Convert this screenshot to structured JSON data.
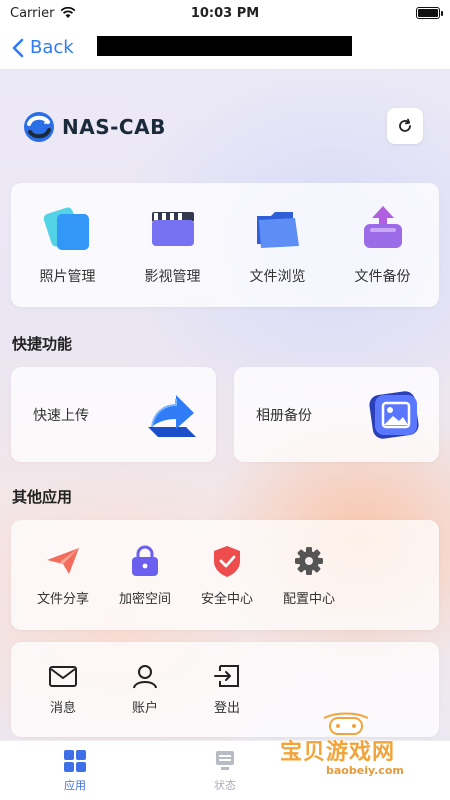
{
  "status_bar": {
    "carrier": "Carrier",
    "time": "10:03 PM"
  },
  "nav": {
    "back_label": "Back"
  },
  "brand": {
    "name": "NAS-CAB",
    "accent": "#2b6fe8"
  },
  "main_tiles": [
    {
      "label": "照片管理",
      "icon": "photos-icon"
    },
    {
      "label": "影视管理",
      "icon": "video-icon"
    },
    {
      "label": "文件浏览",
      "icon": "folder-icon"
    },
    {
      "label": "文件备份",
      "icon": "backup-icon"
    }
  ],
  "quick": {
    "title": "快捷功能",
    "items": [
      {
        "label": "快速上传",
        "icon": "upload-arrow-icon"
      },
      {
        "label": "相册备份",
        "icon": "album-icon"
      }
    ]
  },
  "other": {
    "title": "其他应用",
    "items": [
      {
        "label": "文件分享",
        "icon": "paper-plane-icon"
      },
      {
        "label": "加密空间",
        "icon": "lock-icon"
      },
      {
        "label": "安全中心",
        "icon": "shield-icon"
      },
      {
        "label": "配置中心",
        "icon": "gear-icon"
      }
    ]
  },
  "account_items": [
    {
      "label": "消息",
      "icon": "mail-icon"
    },
    {
      "label": "账户",
      "icon": "user-icon"
    },
    {
      "label": "登出",
      "icon": "logout-icon"
    }
  ],
  "tabs": [
    {
      "label": "应用",
      "icon": "grid-icon",
      "active": true
    },
    {
      "label": "状态",
      "icon": "server-icon",
      "active": false
    },
    {
      "label": "",
      "icon": "",
      "active": false
    }
  ],
  "watermark": {
    "text": "宝贝游戏网",
    "sub": "baobeiy.com"
  },
  "colors": {
    "link": "#2f7cf6",
    "active_tab": "#3f6fe6"
  }
}
